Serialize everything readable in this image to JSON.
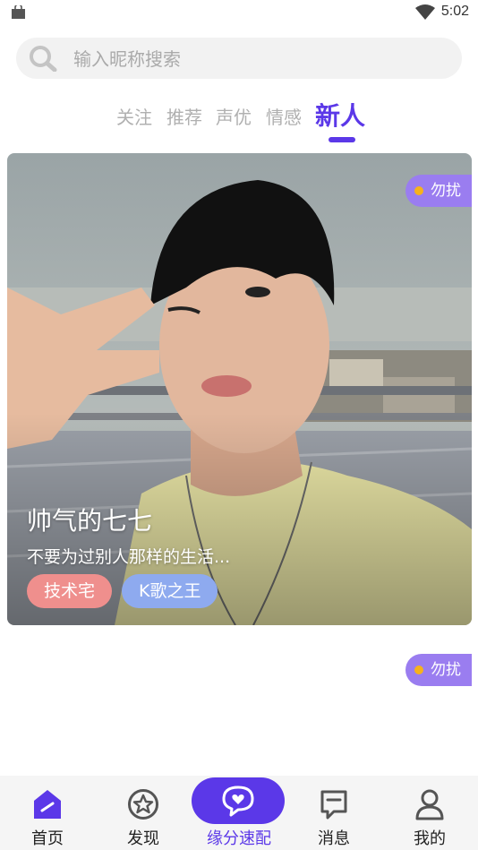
{
  "status_bar": {
    "time": "5:02"
  },
  "search": {
    "placeholder": "输入昵称搜索",
    "value": ""
  },
  "tabs": [
    {
      "label": "关注",
      "active": false
    },
    {
      "label": "推荐",
      "active": false
    },
    {
      "label": "声优",
      "active": false
    },
    {
      "label": "情感",
      "active": false
    },
    {
      "label": "新人",
      "active": true
    }
  ],
  "cards": [
    {
      "name": "帅气的七七",
      "bio": "不要为过别人那样的生活...",
      "tags": [
        "技术宅",
        "K歌之王"
      ],
      "status_badge": "勿扰"
    },
    {
      "status_badge": "勿扰"
    }
  ],
  "bottom_nav": {
    "items": [
      {
        "label": "首页",
        "icon": "home-icon",
        "active": true
      },
      {
        "label": "发现",
        "icon": "star-icon",
        "active": false
      },
      {
        "label": "缘分速配",
        "icon": "heart-chat-icon",
        "active": false
      },
      {
        "label": "消息",
        "icon": "message-icon",
        "active": false
      },
      {
        "label": "我的",
        "icon": "profile-icon",
        "active": false
      }
    ]
  },
  "colors": {
    "accent": "#5b38e8",
    "badge": "#9a7df0",
    "badge_dot": "#f6b21c",
    "tag_pink": "#ef8f8d",
    "tag_blue": "#8eaaef"
  }
}
